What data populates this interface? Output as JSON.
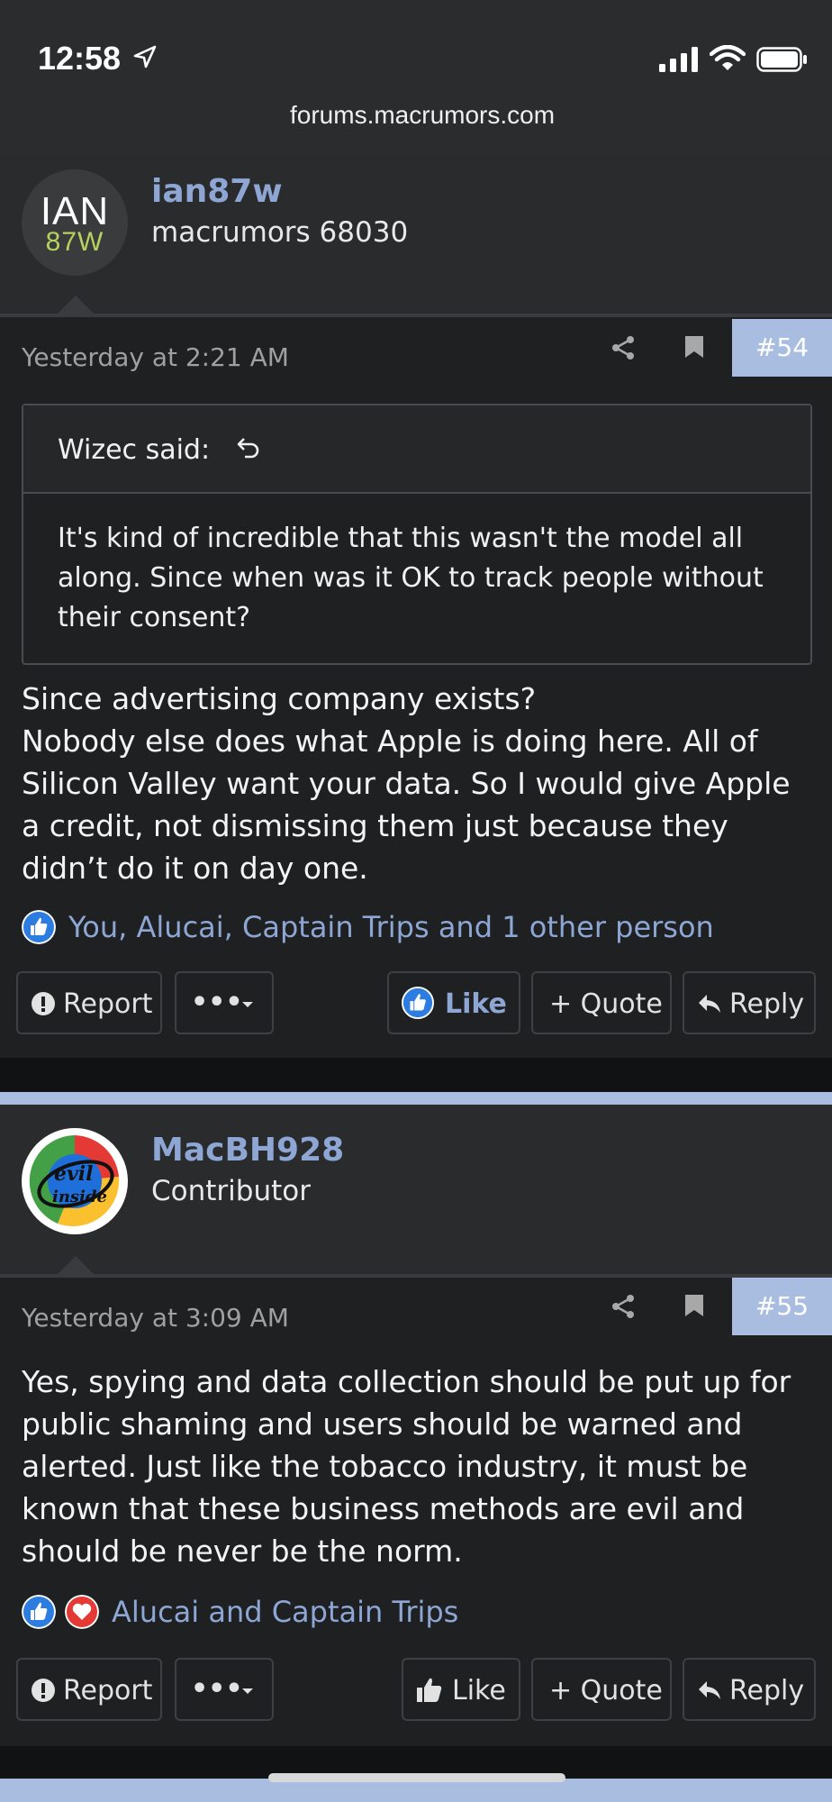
{
  "status": {
    "time": "12:58"
  },
  "browser": {
    "url": "forums.macrumors.com"
  },
  "posts": [
    {
      "avatar": {
        "line1": "IAN",
        "line2": "87W"
      },
      "username": "ian87w",
      "user_title": "macrumors 68030",
      "date": "Yesterday at 2:21 AM",
      "number": "#54",
      "quote": {
        "author": "Wizec said:",
        "text": "It's kind of incredible that this wasn't the model all along. Since when was it OK to track people without their consent?"
      },
      "message": "Since advertising company exists?\nNobody else does what Apple is doing here. All of Silicon Valley want your data. So I would give Apple a credit, not dismissing them just because they didn’t do it on day one.",
      "likers": "You, Alucai, Captain Trips and 1 other person",
      "actions": {
        "report": "Report",
        "more": "•••",
        "like": "Like",
        "quote": "+ Quote",
        "reply": "Reply"
      }
    },
    {
      "avatar": {
        "line1": "evil",
        "line2": "inside"
      },
      "username": "MacBH928",
      "user_title": "Contributor",
      "date": "Yesterday at 3:09 AM",
      "number": "#55",
      "message": "Yes, spying and data collection should be put up for public shaming and users should be warned and alerted. Just like the tobacco industry, it must be known that these business methods are evil and should be never be the norm.",
      "likers": "Alucai and Captain Trips",
      "actions": {
        "report": "Report",
        "more": "•••",
        "like": "Like",
        "quote": "+ Quote",
        "reply": "Reply"
      }
    }
  ],
  "colors": {
    "accent": "#8ea6d4",
    "post_number_bg": "#a8bde0",
    "background": "#1e1f21"
  }
}
